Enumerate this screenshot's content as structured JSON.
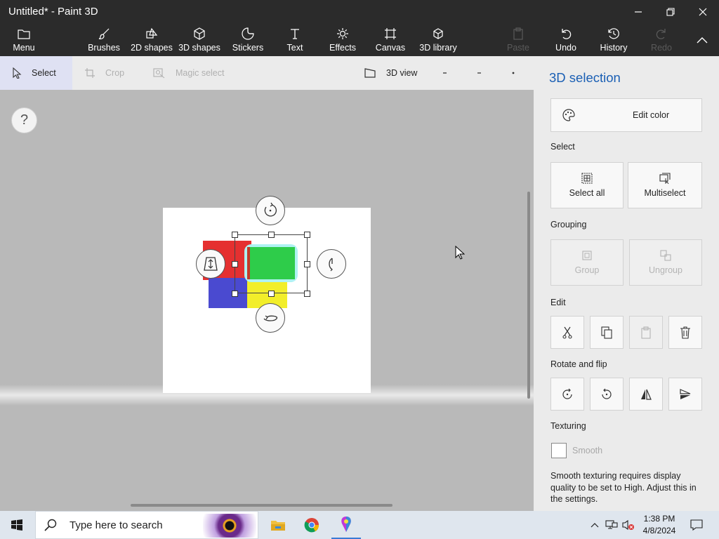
{
  "window": {
    "title": "Untitled* - Paint 3D"
  },
  "toolbar": {
    "menu": "Menu",
    "items": [
      "Brushes",
      "2D shapes",
      "3D shapes",
      "Stickers",
      "Text",
      "Effects",
      "Canvas",
      "3D library"
    ],
    "paste": "Paste",
    "undo": "Undo",
    "history": "History",
    "redo": "Redo"
  },
  "subbar": {
    "select": "Select",
    "crop": "Crop",
    "magic_select": "Magic select",
    "view3d": "3D view"
  },
  "canvas": {
    "help": "?"
  },
  "panel": {
    "title": "3D selection",
    "edit_color": "Edit color",
    "select_section": "Select",
    "select_all": "Select all",
    "multiselect": "Multiselect",
    "grouping_section": "Grouping",
    "group": "Group",
    "ungroup": "Ungroup",
    "edit_section": "Edit",
    "rotate_section": "Rotate and flip",
    "texturing_section": "Texturing",
    "smooth": "Smooth",
    "note": "Smooth texturing requires display quality to be set to High. Adjust this in the settings."
  },
  "taskbar": {
    "search_placeholder": "Type here to search",
    "time": "1:38 PM",
    "date": "4/8/2024"
  },
  "colors": {
    "accent": "#1a5fb4",
    "red": "#e53030",
    "green": "#2ecc4a",
    "blue": "#4a4ad0",
    "yellow": "#f2ee2a"
  }
}
